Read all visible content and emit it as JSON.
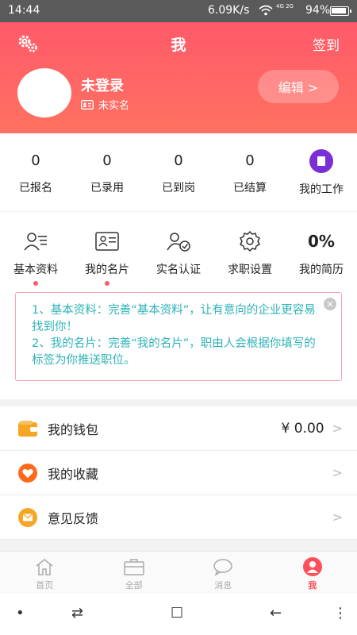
{
  "status_bar": {
    "time": "14:44",
    "speed": "6.09K/s",
    "signal": "4G 2G",
    "battery_pct": "94%",
    "battery_level": 0.94
  },
  "header": {
    "title": "我",
    "signin_label": "签到",
    "username": "未登录",
    "verify_status": "未实名",
    "edit_label": "编辑 >"
  },
  "stats": [
    {
      "num": "0",
      "label": "已报名"
    },
    {
      "num": "0",
      "label": "已录用"
    },
    {
      "num": "0",
      "label": "已到岗"
    },
    {
      "num": "0",
      "label": "已结算"
    }
  ],
  "my_work_label": "我的工作",
  "tools": [
    {
      "label": "基本资料",
      "icon": "profile-icon",
      "dot": true
    },
    {
      "label": "我的名片",
      "icon": "card-icon",
      "dot": true
    },
    {
      "label": "实名认证",
      "icon": "verify-icon",
      "dot": false
    },
    {
      "label": "求职设置",
      "icon": "settings-icon",
      "dot": false
    },
    {
      "label": "我的简历",
      "pct": "0%",
      "dot": false
    }
  ],
  "tip": {
    "line1": "1、基本资料：完善“基本资料”，让有意向的企业更容易找到你！",
    "line2": "2、我的名片：完善“我的名片”，职由人会根据你填写的标签为你推送职位。",
    "close_glyph": "×"
  },
  "list": [
    {
      "label": "我的钱包",
      "value": "¥ 0.00",
      "icon": "wallet-icon",
      "color": "#f5a623"
    },
    {
      "label": "我的收藏",
      "value": "",
      "icon": "heart-icon",
      "color": "#ff6a1a"
    },
    {
      "label": "意见反馈",
      "value": "",
      "icon": "mail-icon",
      "color": "#f5a623"
    }
  ],
  "tabs": [
    {
      "label": "首页",
      "icon": "home-icon"
    },
    {
      "label": "全部",
      "icon": "briefcase-icon"
    },
    {
      "label": "消息",
      "icon": "message-icon"
    },
    {
      "label": "我",
      "icon": "user-icon",
      "active": true
    }
  ],
  "nav": {
    "menu": "•",
    "switch": "⇄",
    "home": "☐",
    "back": "←",
    "more": "⋮"
  },
  "colors": {
    "accent": "#ff5a6a",
    "tip_text": "#2fb3b8",
    "purple": "#7a2fd6"
  }
}
